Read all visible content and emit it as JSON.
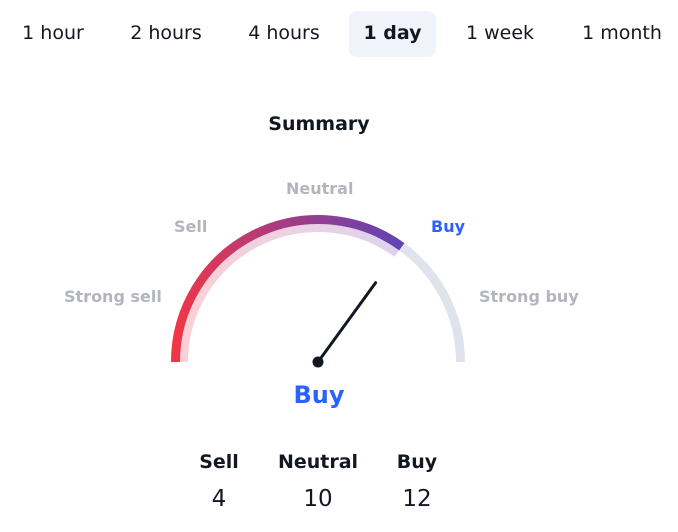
{
  "tabs": [
    {
      "label": "1 hour",
      "active": false
    },
    {
      "label": "2 hours",
      "active": false
    },
    {
      "label": "4 hours",
      "active": false
    },
    {
      "label": "1 day",
      "active": true
    },
    {
      "label": "1 week",
      "active": false
    },
    {
      "label": "1 month",
      "active": false
    }
  ],
  "summary": {
    "title": "Summary",
    "gauge_labels": {
      "strong_sell": "Strong sell",
      "sell": "Sell",
      "neutral": "Neutral",
      "buy": "Buy",
      "strong_buy": "Strong buy"
    },
    "active_label": "buy",
    "gauge_fill_fraction": 0.7,
    "needle_fraction": 0.7,
    "result": "Buy",
    "counts": [
      {
        "label": "Sell",
        "value": "4"
      },
      {
        "label": "Neutral",
        "value": "10"
      },
      {
        "label": "Buy",
        "value": "12"
      }
    ],
    "colors": {
      "accent_blue": "#2962ff",
      "sell_red": "#f23645",
      "buy_purple": "#5b45b8",
      "track_grey": "#e0e3eb",
      "label_grey": "#b2b5be",
      "needle": "#131722"
    }
  }
}
